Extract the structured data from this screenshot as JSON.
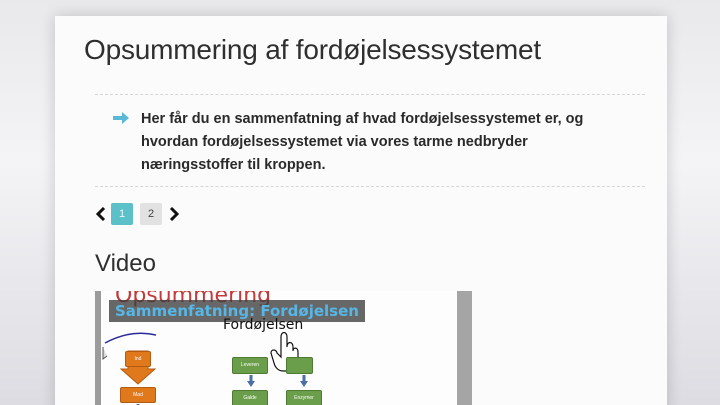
{
  "page": {
    "title": "Opsummering af fordøjelsessystemet",
    "summary": "Her får du en sammenfatning af hvad fordøjelsessystemet er, og hvordan fordøjelsessystemet via vores tarme nedbryder næringsstoffer til kroppen.",
    "pagination": {
      "pages": [
        "1",
        "2"
      ],
      "current": "1"
    },
    "video_heading": "Video"
  },
  "video": {
    "slide_title": "Opsummering",
    "overlay_title": "Sammenfatning: Fordøjelsen",
    "subtitle": "Fordøjelsen",
    "diagram_left": [
      "Ind",
      "Mad"
    ],
    "diagram_right": [
      "Leveren",
      "Galde",
      "Enzymer"
    ]
  },
  "colors": {
    "accent": "#5cc0c8",
    "arrow": "#5bb9d8",
    "slide_title": "#c23a3a",
    "overlay_text": "#56b7e6",
    "box_green": "#6a9e4a",
    "box_orange": "#e0781c"
  }
}
